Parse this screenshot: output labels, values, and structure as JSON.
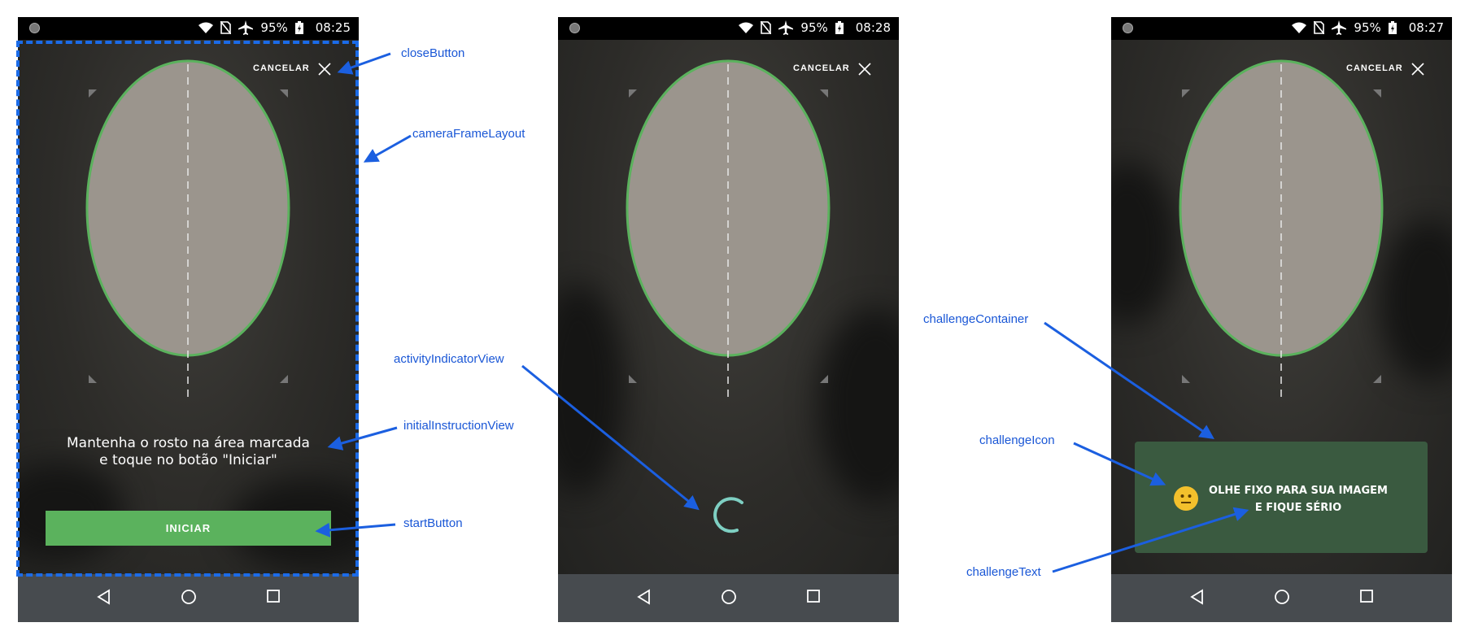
{
  "screens": [
    {
      "status_bar": {
        "battery": "95%",
        "time": "08:25"
      },
      "cancel_label": "CANCELAR",
      "instruction_line1": "Mantenha o rosto na área marcada",
      "instruction_line2": "e toque no botão \"Iniciar\"",
      "start_label": "INICIAR"
    },
    {
      "status_bar": {
        "battery": "95%",
        "time": "08:28"
      },
      "cancel_label": "CANCELAR"
    },
    {
      "status_bar": {
        "battery": "95%",
        "time": "08:27"
      },
      "cancel_label": "CANCELAR",
      "challenge_line1": "OLHE FIXO PARA SUA IMAGEM",
      "challenge_line2": "E FIQUE SÉRIO"
    }
  ],
  "annotations": {
    "close_button": "closeButton",
    "camera_frame_layout": "cameraFrameLayout",
    "initial_instruction_view": "initialInstructionView",
    "start_button": "startButton",
    "activity_indicator_view": "activityIndicatorView",
    "challenge_container": "challengeContainer",
    "challenge_icon": "challengeIcon",
    "challenge_text": "challengeText"
  },
  "colors": {
    "annotation_blue": "#1a57d6",
    "oval_outline": "#5bb25d",
    "start_button": "#5bb25d",
    "spinner": "#7ecfc2",
    "challenge_bg": "#3a5a40",
    "nav_bar": "#474b4f"
  },
  "icons": [
    "wifi-icon",
    "no-sim-icon",
    "airplane-icon",
    "battery-charging-icon",
    "close-icon",
    "back-icon",
    "home-icon",
    "recents-icon",
    "neutral-face-icon",
    "spinner-icon"
  ]
}
